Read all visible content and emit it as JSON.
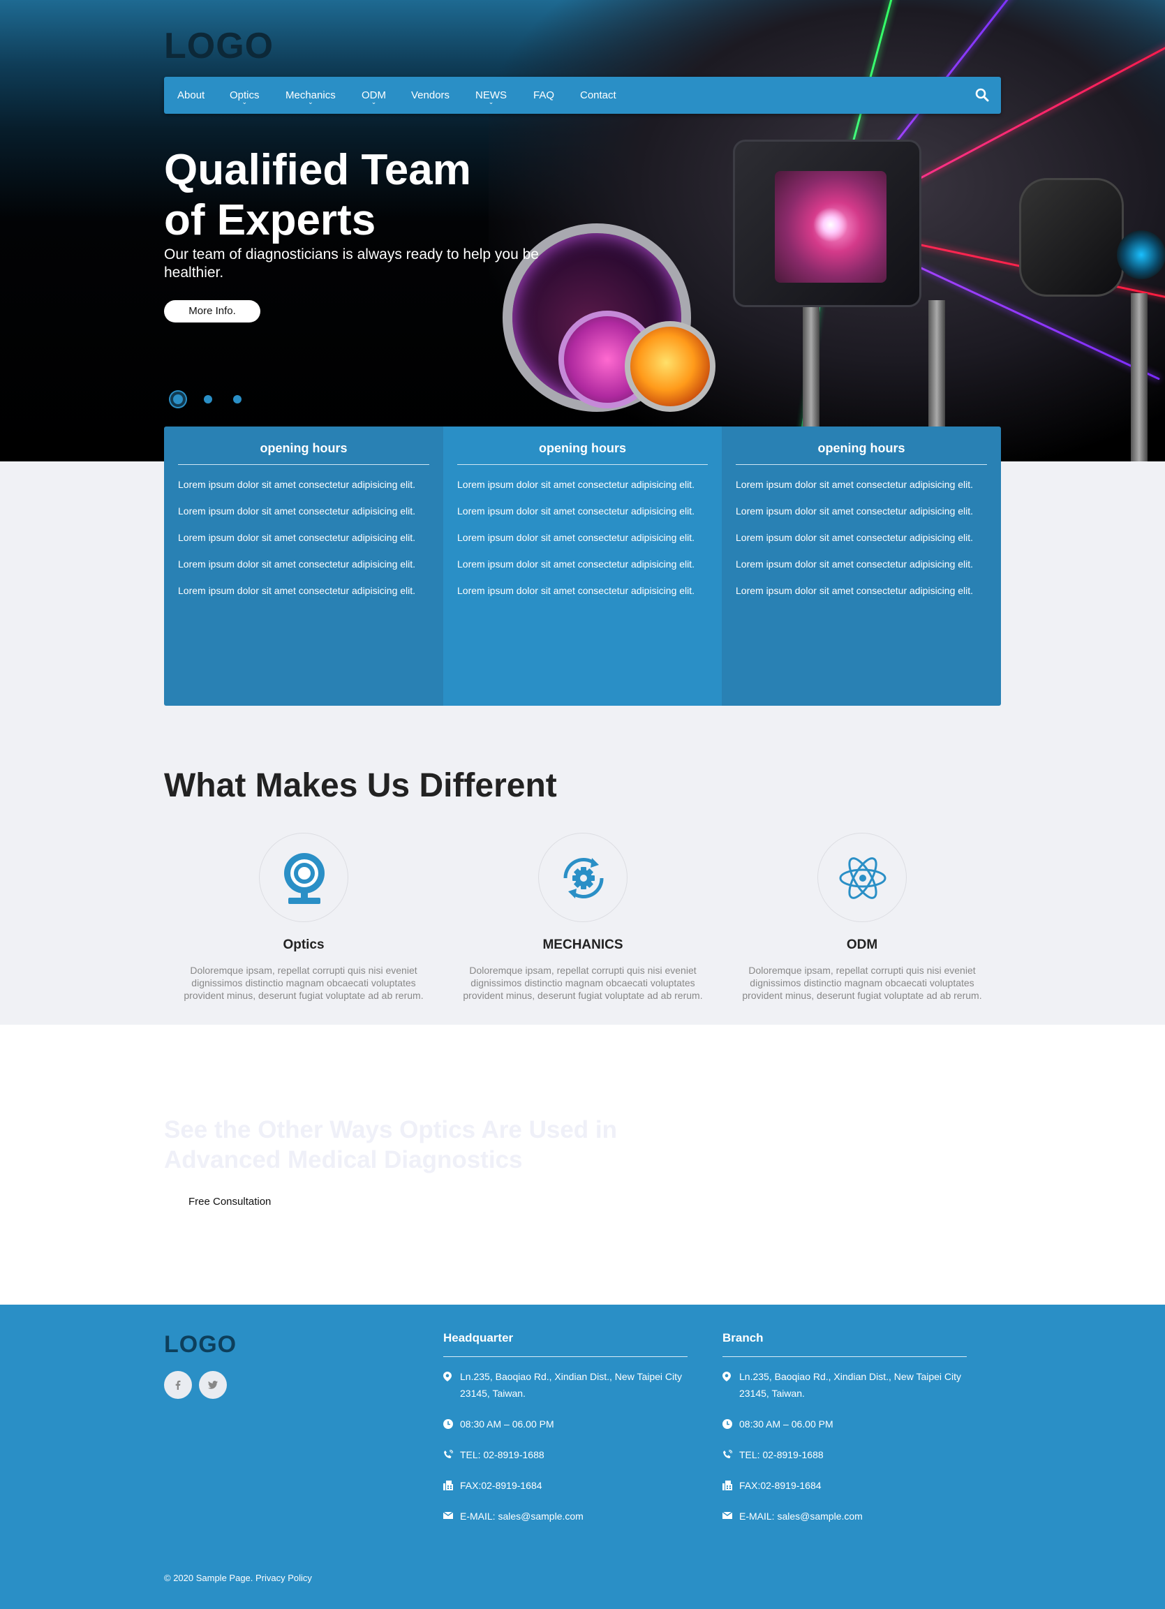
{
  "header": {
    "logo": "LOGO",
    "nav": [
      {
        "label": "About",
        "has_dropdown": false
      },
      {
        "label": "Optics",
        "has_dropdown": true
      },
      {
        "label": "Mechanics",
        "has_dropdown": true
      },
      {
        "label": "ODM",
        "has_dropdown": true
      },
      {
        "label": "Vendors",
        "has_dropdown": false
      },
      {
        "label": "NEWS",
        "has_dropdown": true
      },
      {
        "label": "FAQ",
        "has_dropdown": false
      },
      {
        "label": "Contact",
        "has_dropdown": false
      }
    ],
    "search_icon": "search-icon"
  },
  "hero": {
    "title_line1": "Qualified Team",
    "title_line2": "of Experts",
    "subtitle": "Our team of diagnosticians is always ready to help you be healthier.",
    "button": "More Info.",
    "slides": 3,
    "active_slide": 1
  },
  "hours": [
    {
      "title": "opening hours",
      "lines": [
        "Lorem ipsum dolor sit amet consectetur adipisicing elit.",
        "Lorem ipsum dolor sit amet consectetur adipisicing elit.",
        "Lorem ipsum dolor sit amet consectetur adipisicing elit.",
        "Lorem ipsum dolor sit amet consectetur adipisicing elit.",
        "Lorem ipsum dolor sit amet consectetur adipisicing elit."
      ]
    },
    {
      "title": "opening hours",
      "lines": [
        "Lorem ipsum dolor sit amet consectetur adipisicing elit.",
        "Lorem ipsum dolor sit amet consectetur adipisicing elit.",
        "Lorem ipsum dolor sit amet consectetur adipisicing elit.",
        "Lorem ipsum dolor sit amet consectetur adipisicing elit.",
        "Lorem ipsum dolor sit amet consectetur adipisicing elit."
      ]
    },
    {
      "title": "opening hours",
      "lines": [
        "Lorem ipsum dolor sit amet consectetur adipisicing elit.",
        "Lorem ipsum dolor sit amet consectetur adipisicing elit.",
        "Lorem ipsum dolor sit amet consectetur adipisicing elit.",
        "Lorem ipsum dolor sit amet consectetur adipisicing elit.",
        "Lorem ipsum dolor sit amet consectetur adipisicing elit."
      ]
    }
  ],
  "different": {
    "title": "What Makes Us Different",
    "features": [
      {
        "icon": "webcam-icon",
        "name": "Optics",
        "desc": "Doloremque ipsam, repellat corrupti quis nisi eveniet dignissimos distinctio magnam obcaecati voluptates provident minus, deserunt fugiat voluptate ad ab rerum."
      },
      {
        "icon": "gear-refresh-icon",
        "name": "MECHANICS",
        "desc": "Doloremque ipsam, repellat corrupti quis nisi eveniet dignissimos distinctio magnam obcaecati voluptates provident minus, deserunt fugiat voluptate ad ab rerum."
      },
      {
        "icon": "atom-icon",
        "name": "ODM",
        "desc": "Doloremque ipsam, repellat corrupti quis nisi eveniet dignissimos distinctio magnam obcaecati voluptates provident minus, deserunt fugiat voluptate ad ab rerum."
      }
    ]
  },
  "band": {
    "title_line1": "See the Other Ways Optics Are Used in",
    "title_line2": "Advanced Medical Diagnostics",
    "button": "Free Consultation"
  },
  "footer": {
    "logo": "LOGO",
    "social": [
      "facebook-icon",
      "twitter-icon"
    ],
    "columns": [
      {
        "title": "Headquarter",
        "address": "Ln.235, Baoqiao Rd., Xindian Dist., New Taipei City 23145, Taiwan.",
        "hours": "08:30 AM – 06.00 PM",
        "tel": "TEL: 02-8919-1688",
        "fax": "FAX:02-8919-1684",
        "email": "E-MAIL: sales@sample.com"
      },
      {
        "title": "Branch",
        "address": "Ln.235, Baoqiao Rd., Xindian Dist., New Taipei City 23145, Taiwan.",
        "hours": "08:30 AM – 06.00 PM",
        "tel": "TEL: 02-8919-1688",
        "fax": "FAX:02-8919-1684",
        "email": "E-MAIL: sales@sample.com"
      }
    ],
    "copyright": "© 2020 Sample Page. Privacy Policy"
  },
  "colors": {
    "primary": "#2a8fc6",
    "primary_dark": "#2981b4",
    "page_bg": "#f0f1f5",
    "logo_dark": "#0c2838"
  }
}
